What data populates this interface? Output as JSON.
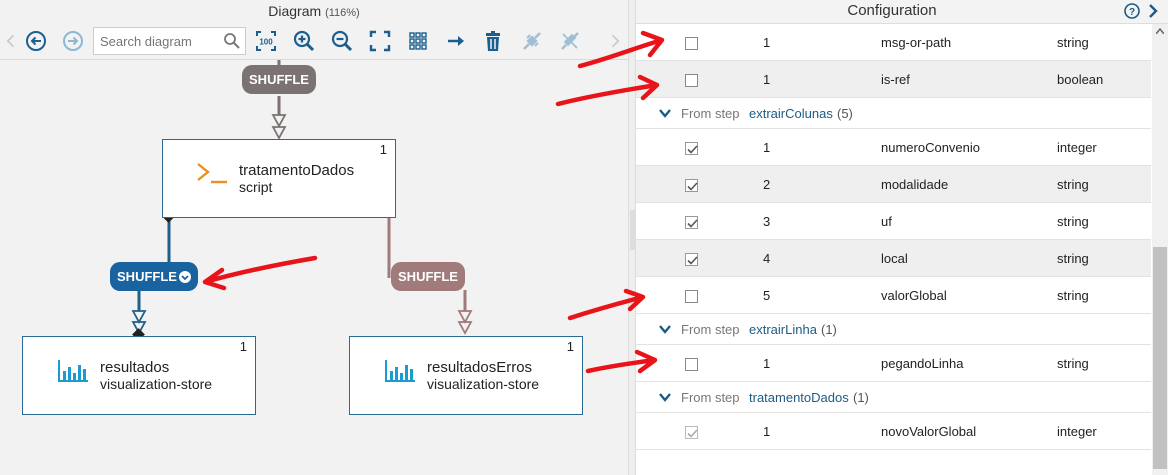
{
  "diagram": {
    "title": "Diagram",
    "zoom": "(116%)",
    "search_placeholder": "Search diagram",
    "toolbar_icons": [
      "chevron-left-icon",
      "back-icon",
      "forward-icon",
      "search-icon",
      "zoom-100-icon",
      "zoom-in-icon",
      "zoom-out-icon",
      "fit-screen-icon",
      "grid-icon",
      "arrow-right-icon",
      "trash-icon",
      "connect-icon",
      "disconnect-icon",
      "chevron-right-icon"
    ],
    "zoom_100_label": "100",
    "shuffles": {
      "top": "SHUFFLE",
      "left": "SHUFFLE",
      "right": "SHUFFLE"
    },
    "nodes": {
      "script": {
        "name": "tratamentoDados",
        "kind": "script",
        "count": "1",
        "icon": "terminal-icon"
      },
      "results": {
        "name": "resultados",
        "kind": "visualization-store",
        "count": "1",
        "icon": "bar-chart-icon"
      },
      "errors": {
        "name": "resultadosErros",
        "kind": "visualization-store",
        "count": "1",
        "icon": "bar-chart-icon"
      }
    },
    "colors": {
      "main_edge": "#1f5f8b",
      "error_edge": "#a07a7a",
      "shuffle_grey": "#7a7371",
      "shuffle_blue": "#1863a0",
      "shuffle_rose": "#a17b7b",
      "node_border": "#2b6a94",
      "icon_orange": "#e8911f",
      "icon_teal": "#1b9bd1"
    }
  },
  "config": {
    "title": "Configuration",
    "rows_top": [
      {
        "index": "1",
        "field": "msg-or-path",
        "type": "string",
        "checked": false
      },
      {
        "index": "1",
        "field": "is-ref",
        "type": "boolean",
        "checked": false
      }
    ],
    "groups": [
      {
        "from_label": "From step",
        "step": "extrairColunas",
        "count": "(5)",
        "rows": [
          {
            "index": "1",
            "field": "numeroConvenio",
            "type": "integer",
            "checked": true
          },
          {
            "index": "2",
            "field": "modalidade",
            "type": "string",
            "checked": true
          },
          {
            "index": "3",
            "field": "uf",
            "type": "string",
            "checked": true
          },
          {
            "index": "4",
            "field": "local",
            "type": "string",
            "checked": true
          },
          {
            "index": "5",
            "field": "valorGlobal",
            "type": "string",
            "checked": false
          }
        ]
      },
      {
        "from_label": "From step",
        "step": "extrairLinha",
        "count": "(1)",
        "rows": [
          {
            "index": "1",
            "field": "pegandoLinha",
            "type": "string",
            "checked": false
          }
        ]
      },
      {
        "from_label": "From step",
        "step": "tratamentoDados",
        "count": "(1)",
        "rows": [
          {
            "index": "1",
            "field": "novoValorGlobal",
            "type": "integer",
            "checked": true,
            "disabled": true
          }
        ]
      }
    ]
  },
  "annotation_color": "#e8141a"
}
